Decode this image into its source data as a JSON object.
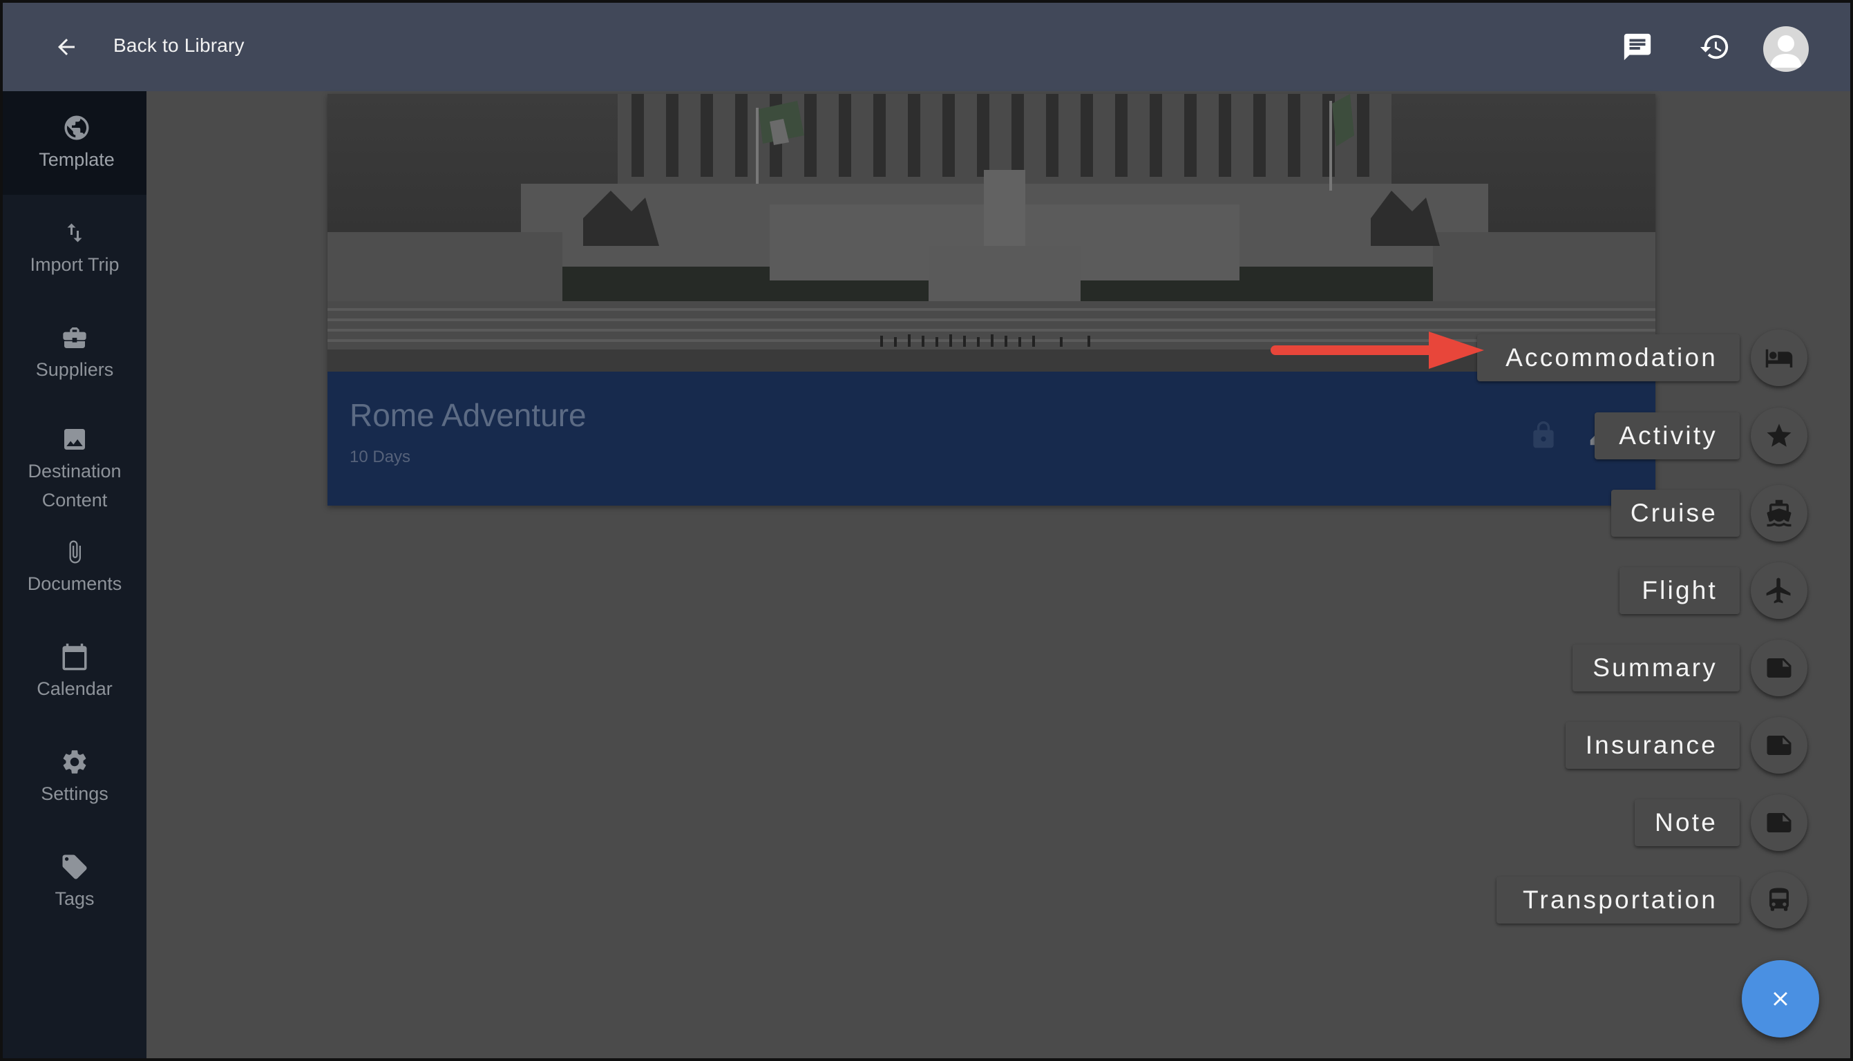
{
  "header": {
    "back_label": "Back to Library",
    "icons": [
      "arrow-left-icon",
      "chat-icon",
      "history-icon",
      "avatar"
    ]
  },
  "sidebar": {
    "items": [
      {
        "label": "Template",
        "icon": "globe-icon"
      },
      {
        "label": "Import Trip",
        "icon": "swap-vertical-icon"
      },
      {
        "label": "Suppliers",
        "icon": "briefcase-icon"
      },
      {
        "label": "Destination Content",
        "icon": "image-icon"
      },
      {
        "label": "Documents",
        "icon": "paperclip-icon"
      },
      {
        "label": "Calendar",
        "icon": "calendar-icon"
      },
      {
        "label": "Settings",
        "icon": "gear-icon"
      },
      {
        "label": "Tags",
        "icon": "tag-icon"
      }
    ]
  },
  "trip": {
    "title": "Rome Adventure",
    "duration": "10 Days"
  },
  "speed_dial": {
    "items": [
      {
        "label": "Accommodation",
        "icon": "bed-icon"
      },
      {
        "label": "Activity",
        "icon": "star-icon"
      },
      {
        "label": "Cruise",
        "icon": "ship-icon"
      },
      {
        "label": "Flight",
        "icon": "airplane-icon"
      },
      {
        "label": "Summary",
        "icon": "note-icon"
      },
      {
        "label": "Insurance",
        "icon": "note-icon"
      },
      {
        "label": "Note",
        "icon": "note-icon"
      },
      {
        "label": "Transportation",
        "icon": "bus-icon"
      }
    ],
    "close_icon": "close-icon"
  },
  "colors": {
    "topbar": "#414859",
    "sidebar": "#141a24",
    "overlay_bg": "#4b4b4b",
    "fab": "#4a90e2",
    "annotation_arrow": "#e8463a"
  }
}
